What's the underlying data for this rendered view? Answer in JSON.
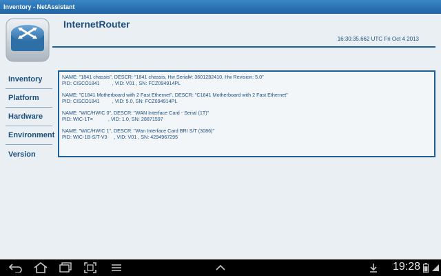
{
  "window": {
    "title": "Inventory - NetAssistant"
  },
  "header": {
    "device_name": "InternetRouter",
    "timestamp": "16:30:35.662 UTC Fri Oct 4 2013"
  },
  "sidebar": {
    "items": [
      {
        "label": "Inventory"
      },
      {
        "label": "Platform"
      },
      {
        "label": "Hardware"
      },
      {
        "label": "Environment"
      },
      {
        "label": "Version"
      }
    ]
  },
  "inventory": [
    {
      "line1": "NAME: \"1841 chassis\", DESCR: \"1841 chassis, Hw Serial#: 3601282410, Hw Revision: 5.0\"",
      "line2": "PID: CISCO1841         , VID: V01 , SN: FCZ094914PL"
    },
    {
      "line1": "NAME: \"C1841 Motherboard with 2 Fast Ethernet\", DESCR: \"C1841 Motherboard with 2 Fast Ethernet\"",
      "line2": "PID: CISCO1841         , VID: 5.0, SN: FCZ094914PL"
    },
    {
      "line1": "NAME: \"WIC/HWIC 0\", DESCR: \"WAN Interface Card - Serial (1T)\"",
      "line2": "PID: WIC-1T=           , VID: 1.0, SN: 28871597"
    },
    {
      "line1": "NAME: \"WIC/HWIC 1\", DESCR: \"Wan Interface Card BRI S/T (3086)\"",
      "line2": "PID: WIC-1B-S/T-V3     , VID: V01 , SN: 4294967295"
    }
  ],
  "status_bar": {
    "time": "19:28"
  },
  "colors": {
    "accent": "#1f5f98",
    "text": "#1d4f7e",
    "title_bar": "#2a73b5"
  }
}
